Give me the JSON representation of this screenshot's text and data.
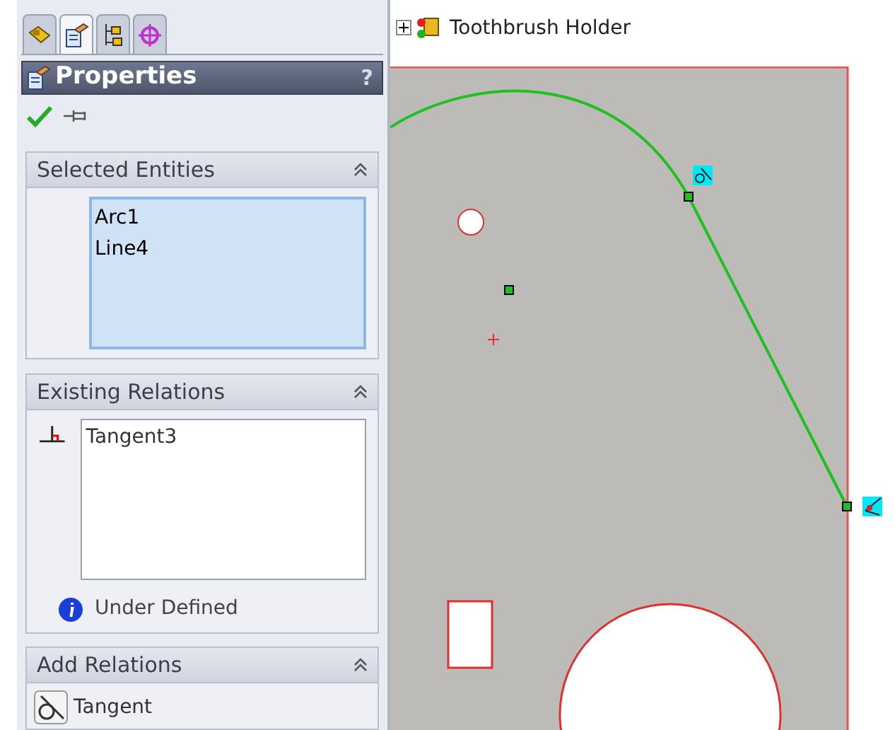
{
  "tabs": [
    {
      "kind": "feature",
      "selected": false
    },
    {
      "kind": "property",
      "selected": true
    },
    {
      "kind": "config",
      "selected": false
    },
    {
      "kind": "dim",
      "selected": false
    }
  ],
  "panel": {
    "title": "Properties",
    "help": "?"
  },
  "selected_entities": {
    "title": "Selected Entities",
    "expanded": true,
    "items": [
      "Arc1",
      "Line4"
    ]
  },
  "existing_relations": {
    "title": "Existing Relations",
    "expanded": true,
    "items": [
      "Tangent3"
    ],
    "status": "Under Defined"
  },
  "add_relations": {
    "title": "Add Relations",
    "expanded": true,
    "items": [
      "Tangent"
    ]
  },
  "tree": {
    "expanded": false,
    "label": "Toothbrush Holder"
  }
}
